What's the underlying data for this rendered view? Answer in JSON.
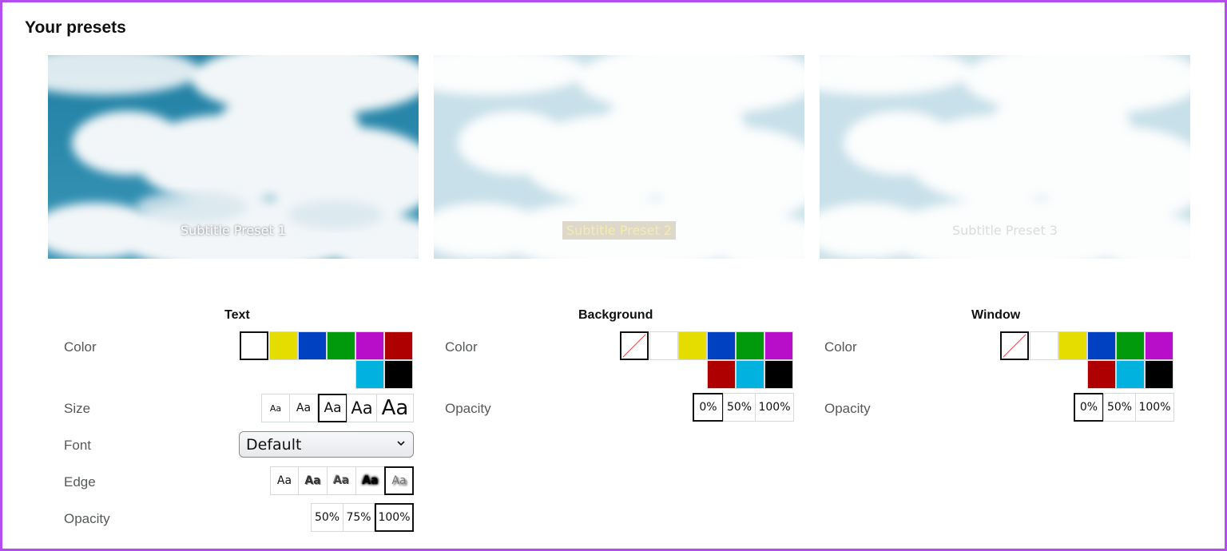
{
  "page_title": "Your presets",
  "previews": [
    {
      "caption": "Subtitle Preset 1"
    },
    {
      "caption": "Subtitle Preset 2"
    },
    {
      "caption": "Subtitle Preset 3"
    }
  ],
  "colors": {
    "frame": "#b54cf0",
    "swatches": {
      "white": "#ffffff",
      "yellow": "#e5dd00",
      "blue": "#0041c2",
      "green": "#029a0d",
      "magenta": "#b90ec9",
      "red": "#ae0000",
      "cyan": "#00b2dd",
      "black": "#000000"
    }
  },
  "text_panel": {
    "heading": "Text",
    "color_label": "Color",
    "color_options": [
      "white",
      "yellow",
      "blue",
      "green",
      "magenta",
      "red",
      "cyan",
      "black"
    ],
    "color_selected": "white",
    "size_label": "Size",
    "size_options": [
      "Aa",
      "Aa",
      "Aa",
      "Aa",
      "Aa"
    ],
    "size_selected_index": 2,
    "font_label": "Font",
    "font_value": "Default",
    "edge_label": "Edge",
    "edge_options": [
      "Aa",
      "Aa",
      "Aa",
      "Aa",
      "Aa"
    ],
    "edge_selected_index": 4,
    "opacity_label": "Opacity",
    "opacity_options": [
      "50%",
      "75%",
      "100%"
    ],
    "opacity_selected": "100%"
  },
  "background_panel": {
    "heading": "Background",
    "color_label": "Color",
    "color_options": [
      "none",
      "white",
      "yellow",
      "blue",
      "green",
      "magenta",
      "red",
      "cyan",
      "black"
    ],
    "color_selected": "none",
    "opacity_label": "Opacity",
    "opacity_options": [
      "0%",
      "50%",
      "100%"
    ],
    "opacity_selected": "0%"
  },
  "window_panel": {
    "heading": "Window",
    "color_label": "Color",
    "color_options": [
      "none",
      "white",
      "yellow",
      "blue",
      "green",
      "magenta",
      "red",
      "cyan",
      "black"
    ],
    "color_selected": "none",
    "opacity_label": "Opacity",
    "opacity_options": [
      "0%",
      "50%",
      "100%"
    ],
    "opacity_selected": "0%"
  },
  "icons": {
    "select_chevron": "chevron-down-icon",
    "no_color": "no-color-slash-icon"
  }
}
